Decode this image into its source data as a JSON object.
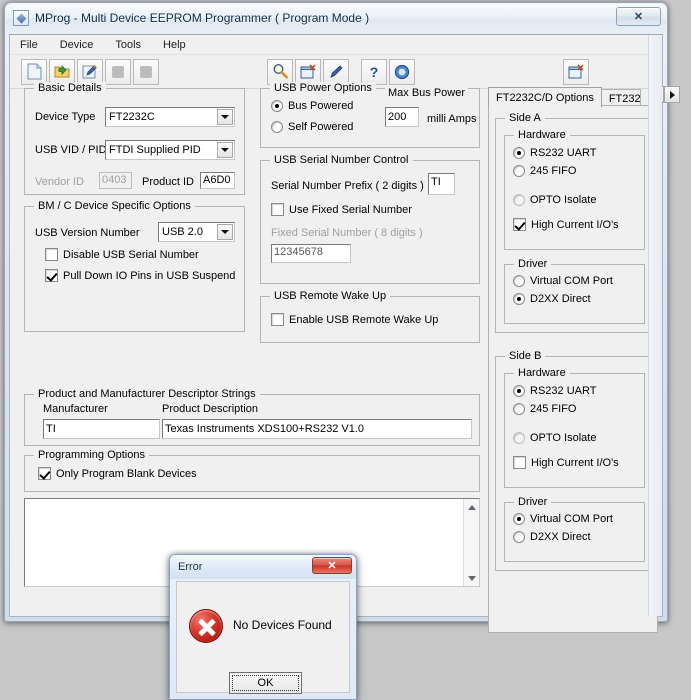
{
  "window": {
    "title": "MProg - Multi Device EEPROM Programmer ( Program Mode )",
    "app_icon": "mprog-pencil-icon",
    "close_label": "✕"
  },
  "menu": [
    "File",
    "Device",
    "Tools",
    "Help"
  ],
  "toolbar": {
    "left": [
      "new-file-icon",
      "open-folder-icon",
      "edit-pencil-icon",
      "save-disabled-icon",
      "save-all-disabled-icon"
    ],
    "middle": [
      "scan-magnifier-icon",
      "program-window-icon",
      "erase-pencil-icon",
      "help-question-icon",
      "about-info-icon"
    ],
    "right": [
      "new-window-icon"
    ]
  },
  "basic_details": {
    "title": "Basic Details",
    "device_type_label": "Device Type",
    "device_type_value": "FT2232C",
    "usb_vid_pid_label": "USB VID / PID",
    "usb_vid_pid_value": "FTDI Supplied PID",
    "vendor_id_label": "Vendor ID",
    "vendor_id_value": "0403",
    "product_id_label": "Product ID",
    "product_id_value": "A6D0"
  },
  "bm_c_options": {
    "title": "BM / C Device Specific Options",
    "usb_version_label": "USB Version Number",
    "usb_version_value": "USB 2.0",
    "disable_serial_label": "Disable USB Serial Number",
    "disable_serial_checked": false,
    "pulldown_label": "Pull Down IO Pins in USB Suspend",
    "pulldown_checked": true
  },
  "usb_power": {
    "title": "USB Power Options",
    "bus_powered_label": "Bus Powered",
    "self_powered_label": "Self Powered",
    "selected": "Bus Powered",
    "max_bus_power_label": "Max Bus Power",
    "max_bus_power_value": "200",
    "units_label": "milli Amps"
  },
  "usb_serial": {
    "title": "USB Serial Number Control",
    "prefix_label": "Serial Number Prefix ( 2 digits )",
    "prefix_value": "TI",
    "use_fixed_label": "Use Fixed Serial Number",
    "use_fixed_checked": false,
    "fixed_label": "Fixed Serial Number ( 8 digits )",
    "fixed_value": "12345678"
  },
  "remote_wakeup": {
    "title": "USB Remote Wake Up",
    "enable_label": "Enable USB Remote Wake Up",
    "enable_checked": false
  },
  "descriptor_strings": {
    "title": "Product and Manufacturer Descriptor Strings",
    "manufacturer_label": "Manufacturer",
    "manufacturer_value": "TI",
    "product_label": "Product Description",
    "product_value": "Texas Instruments XDS100+RS232 V1.0"
  },
  "programming_options": {
    "title": "Programming Options",
    "blank_only_label": "Only Program Blank Devices",
    "blank_only_checked": true
  },
  "log": {
    "text": ""
  },
  "tabs": {
    "selected": "FT2232C/D Options",
    "items": [
      "FT2232C/D Options",
      "FT232"
    ],
    "prev_icon": "chevron-left-icon",
    "next_icon": "chevron-right-icon"
  },
  "side_a": {
    "title": "Side A",
    "hardware_title": "Hardware",
    "rs232_label": "RS232 UART",
    "fifo_label": "245 FIFO",
    "opto_label": "OPTO Isolate",
    "hardware_selected": "RS232 UART",
    "high_current_label": "High Current I/O's",
    "high_current_checked": true,
    "driver_title": "Driver",
    "vcp_label": "Virtual COM Port",
    "d2xx_label": "D2XX Direct",
    "driver_selected": "D2XX Direct"
  },
  "side_b": {
    "title": "Side B",
    "hardware_title": "Hardware",
    "rs232_label": "RS232 UART",
    "fifo_label": "245 FIFO",
    "opto_label": "OPTO Isolate",
    "hardware_selected": "RS232 UART",
    "high_current_label": "High Current I/O's",
    "high_current_checked": false,
    "driver_title": "Driver",
    "vcp_label": "Virtual COM Port",
    "d2xx_label": "D2XX Direct",
    "driver_selected": "Virtual COM Port"
  },
  "error_dialog": {
    "title": "Error",
    "message": "No Devices Found",
    "ok_label": "OK",
    "close_label": "✕",
    "icon": "error-cross-icon"
  },
  "colors": {
    "accent": "#c33828",
    "window_bg": "#f0f0f0",
    "desktop": "#c8c8c8"
  }
}
